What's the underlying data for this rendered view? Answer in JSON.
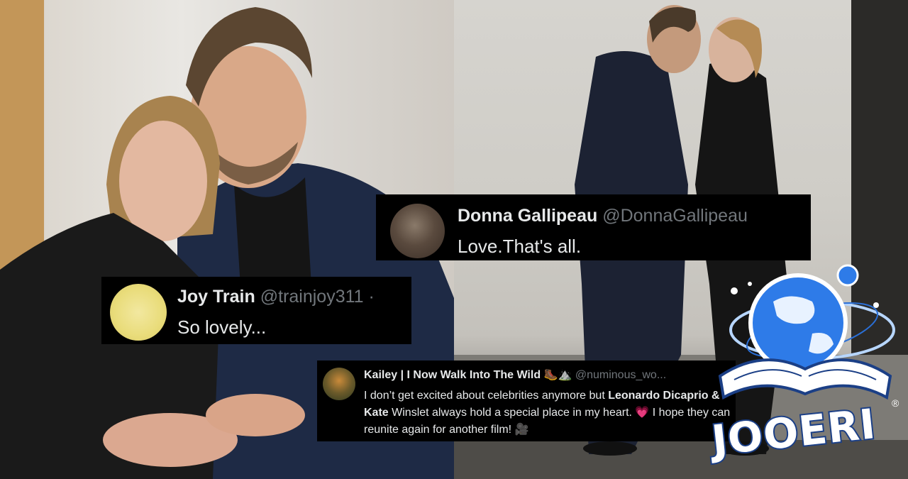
{
  "tweets": [
    {
      "name": "Donna Gallipeau",
      "handle": "@DonnaGallipeau",
      "text": "Love.That's all."
    },
    {
      "name": "Joy Train",
      "handle": "@trainjoy311 ·",
      "text": "So lovely..."
    },
    {
      "name": "Kailey | I Now Walk Into The Wild",
      "handle": "@numinous_wo...",
      "text_before": "I don’t get excited about celebrities anymore but ",
      "text_bold": "Leonardo Dicaprio & Kate",
      "text_after": " Winslet always hold a special place in my heart. 💗 I hope they can reunite again for another film! 🎥",
      "emoji": "🥾⛰️"
    }
  ],
  "logo": {
    "text": "JOOERI",
    "registered": "®"
  },
  "colors": {
    "tweet_bg": "#000000",
    "name": "#e7e9ea",
    "handle": "#71767b",
    "logo_blue": "#1e6fd9"
  }
}
